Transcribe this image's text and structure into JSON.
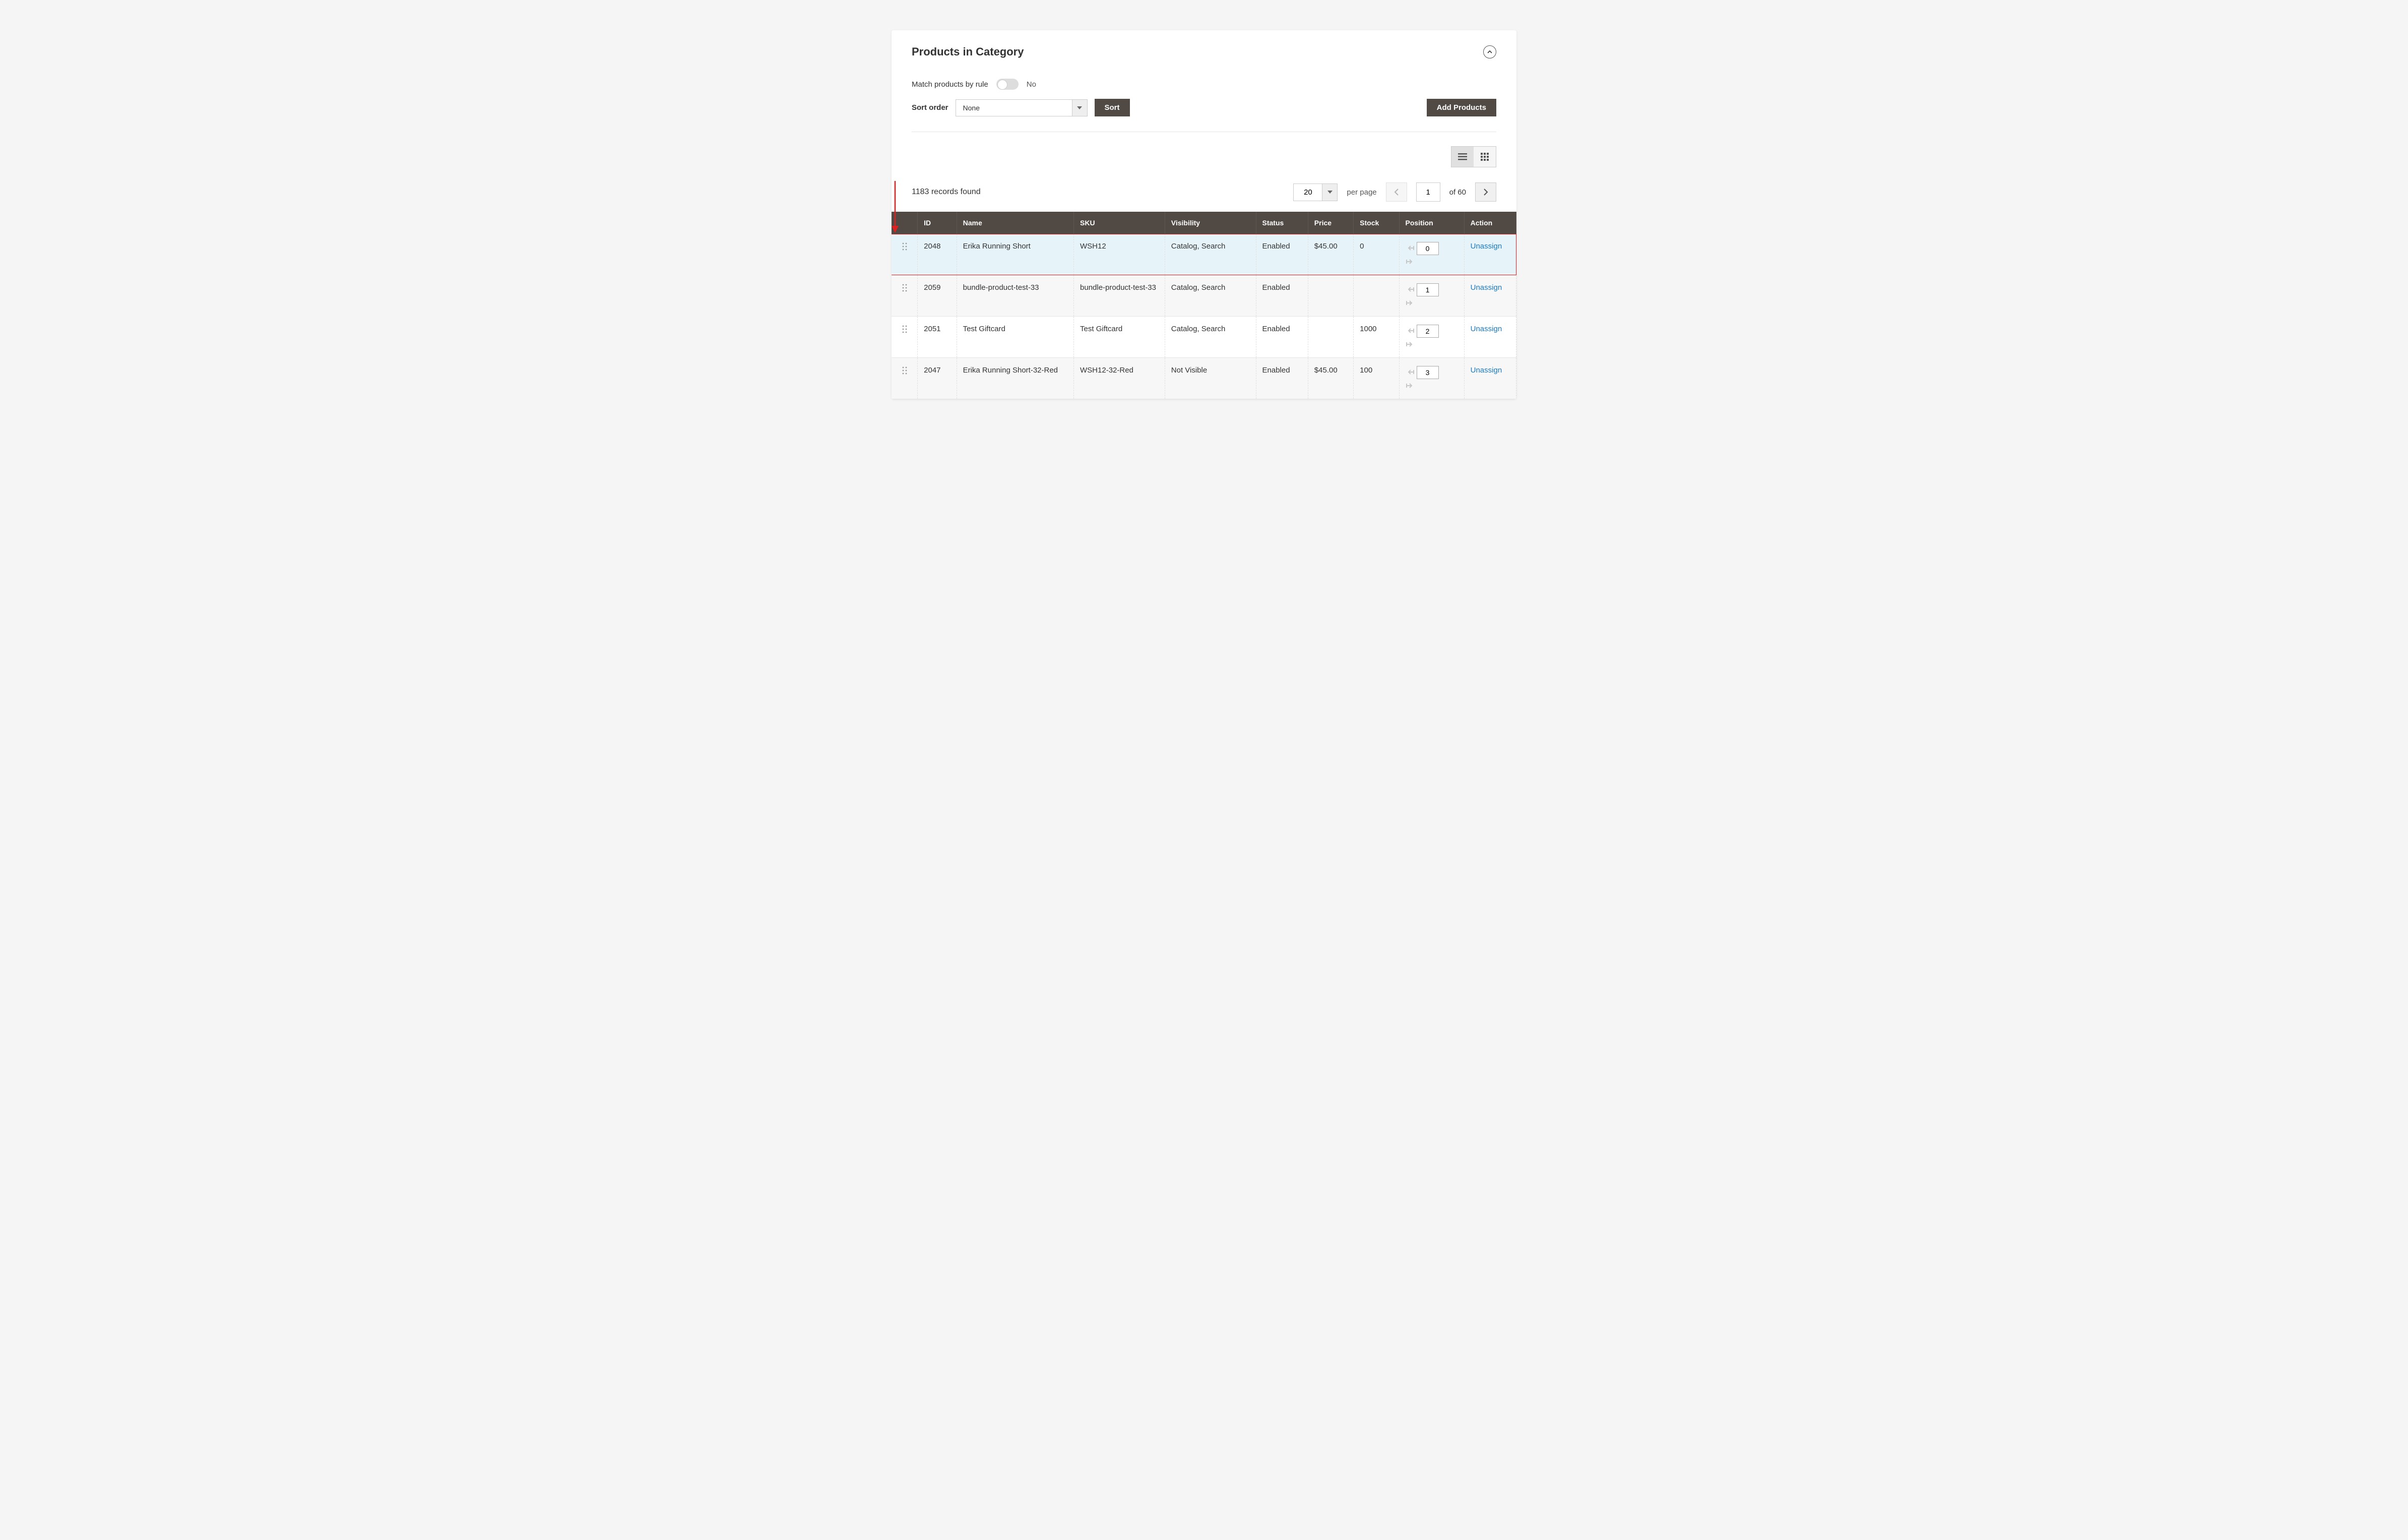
{
  "panel": {
    "title": "Products in Category",
    "match_label": "Match products by rule",
    "match_state": "No",
    "sort_label": "Sort order",
    "sort_value": "None",
    "sort_button": "Sort",
    "add_button": "Add Products"
  },
  "pager": {
    "records_found": "1183 records found",
    "page_size": "20",
    "per_page_label": "per page",
    "current_page": "1",
    "of_pages": "of 60"
  },
  "columns": {
    "drag": "",
    "id": "ID",
    "name": "Name",
    "sku": "SKU",
    "visibility": "Visibility",
    "status": "Status",
    "price": "Price",
    "stock": "Stock",
    "position": "Position",
    "action": "Action"
  },
  "rows": [
    {
      "id": "2048",
      "name": "Erika Running Short",
      "sku": "WSH12",
      "visibility": "Catalog, Search",
      "status": "Enabled",
      "price": "$45.00",
      "stock": "0",
      "position": "0",
      "action": "Unassign",
      "highlight": true
    },
    {
      "id": "2059",
      "name": "bundle-product-test-33",
      "sku": "bundle-product-test-33",
      "visibility": "Catalog, Search",
      "status": "Enabled",
      "price": "",
      "stock": "",
      "position": "1",
      "action": "Unassign",
      "highlight": false
    },
    {
      "id": "2051",
      "name": "Test Giftcard",
      "sku": "Test Giftcard",
      "visibility": "Catalog, Search",
      "status": "Enabled",
      "price": "",
      "stock": "1000",
      "position": "2",
      "action": "Unassign",
      "highlight": false
    },
    {
      "id": "2047",
      "name": "Erika Running Short-32-Red",
      "sku": "WSH12-32-Red",
      "visibility": "Not Visible",
      "status": "Enabled",
      "price": "$45.00",
      "stock": "100",
      "position": "3",
      "action": "Unassign",
      "highlight": false
    }
  ]
}
